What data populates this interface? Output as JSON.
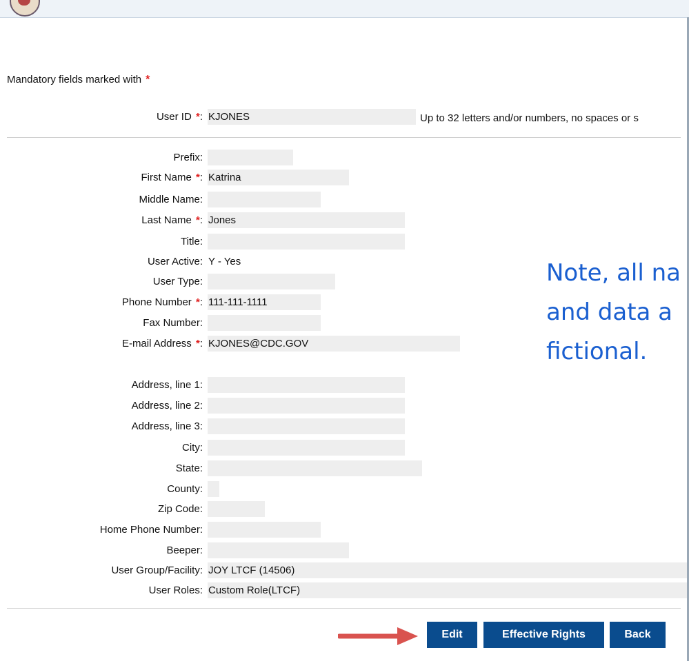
{
  "mandatory_text": "Mandatory fields marked with",
  "required_marker": "*",
  "user_id": {
    "label": "User ID",
    "value": "KJONES",
    "hint": "Up to 32 letters and/or numbers, no spaces or s"
  },
  "fields": {
    "prefix": {
      "label": "Prefix:",
      "value": ""
    },
    "first_name": {
      "label": "First Name",
      "value": "Katrina"
    },
    "middle_name": {
      "label": "Middle Name:",
      "value": ""
    },
    "last_name": {
      "label": "Last Name",
      "value": "Jones"
    },
    "title": {
      "label": "Title:",
      "value": ""
    },
    "user_active": {
      "label": "User Active:",
      "value": "Y - Yes"
    },
    "user_type": {
      "label": "User Type:",
      "value": ""
    },
    "phone": {
      "label": "Phone Number",
      "value": "111-111-1111"
    },
    "fax": {
      "label": "Fax Number:",
      "value": ""
    },
    "email": {
      "label": "E-mail Address",
      "value": "KJONES@CDC.GOV"
    },
    "address1": {
      "label": "Address, line 1:",
      "value": ""
    },
    "address2": {
      "label": "Address, line 2:",
      "value": ""
    },
    "address3": {
      "label": "Address, line 3:",
      "value": ""
    },
    "city": {
      "label": "City:",
      "value": ""
    },
    "state": {
      "label": "State:",
      "value": ""
    },
    "county": {
      "label": "County:",
      "value": ""
    },
    "zip": {
      "label": "Zip Code:",
      "value": ""
    },
    "home_phone": {
      "label": "Home Phone Number:",
      "value": ""
    },
    "beeper": {
      "label": "Beeper:",
      "value": ""
    },
    "user_group": {
      "label": "User Group/Facility:",
      "value": "JOY LTCF (14506)"
    },
    "user_roles": {
      "label": "User Roles:",
      "value": "Custom Role(LTCF)"
    }
  },
  "note_lines": [
    "Note, all na",
    "and data a",
    "fictional."
  ],
  "buttons": {
    "edit": "Edit",
    "effective_rights": "Effective Rights",
    "back": "Back"
  },
  "colors": {
    "button_bg": "#0a4c8e",
    "required": "#e02020",
    "note_text": "#1a5fd0",
    "arrow": "#d9534f",
    "field_bg": "#eeeeee"
  },
  "icons": {
    "logo": "logo-fragment",
    "arrow": "arrow-right-icon"
  }
}
